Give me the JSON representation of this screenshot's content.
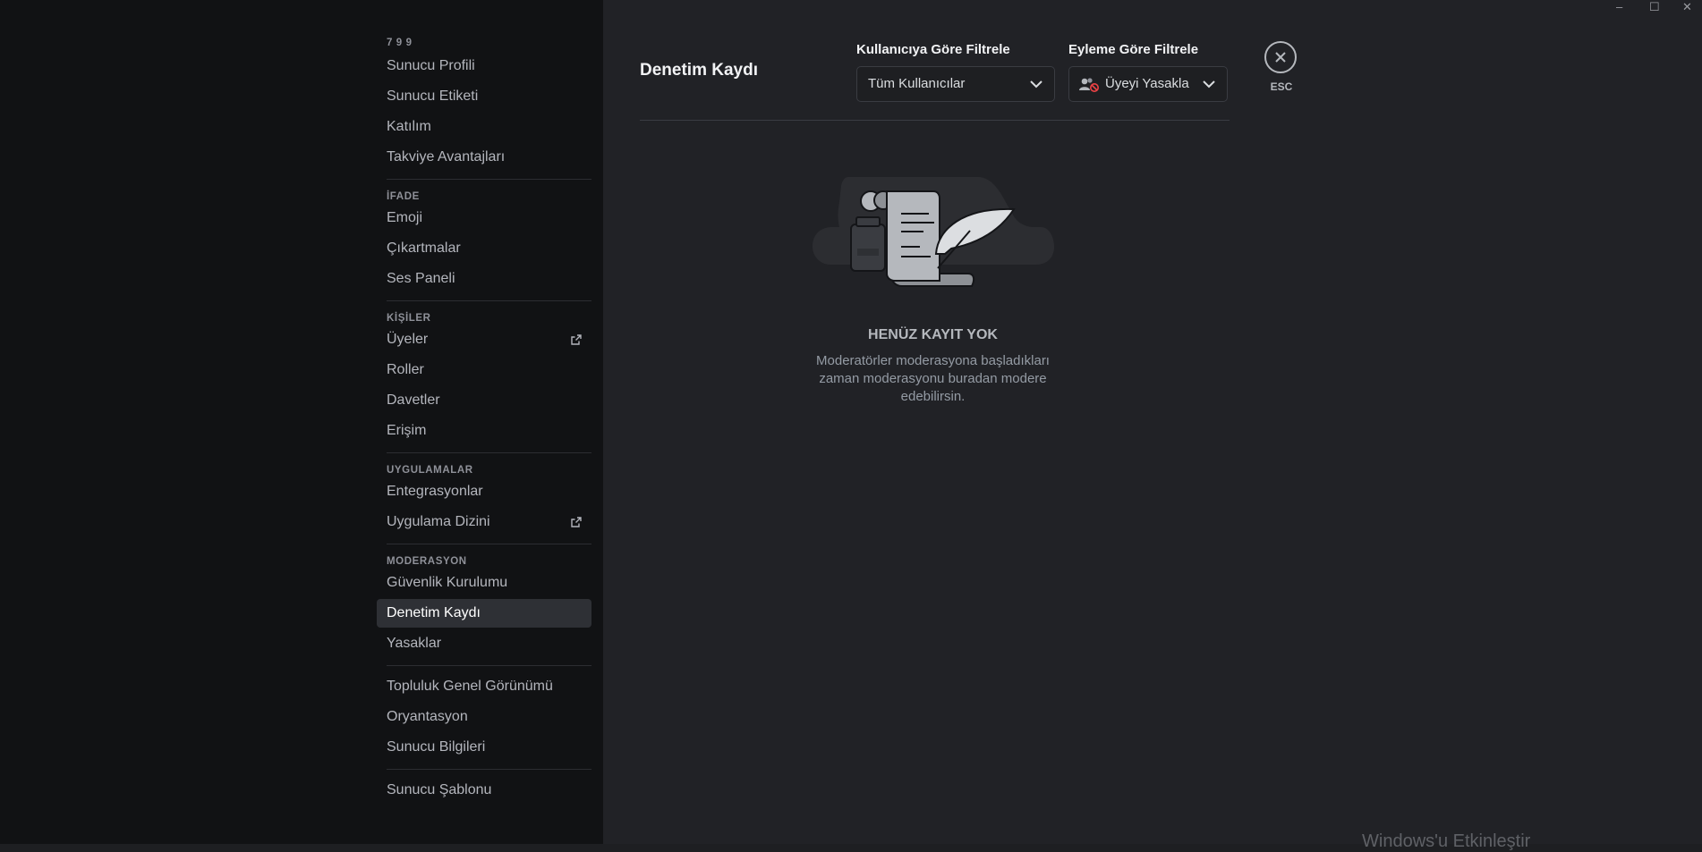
{
  "sidebar": {
    "sections": [
      {
        "header": "7 9 9",
        "items": [
          {
            "label": "Sunucu Profili"
          },
          {
            "label": "Sunucu Etiketi"
          },
          {
            "label": "Katılım"
          },
          {
            "label": "Takviye Avantajları"
          }
        ]
      },
      {
        "header": "İFADE",
        "items": [
          {
            "label": "Emoji"
          },
          {
            "label": "Çıkartmalar"
          },
          {
            "label": "Ses Paneli"
          }
        ]
      },
      {
        "header": "KİŞİLER",
        "items": [
          {
            "label": "Üyeler",
            "external": true
          },
          {
            "label": "Roller"
          },
          {
            "label": "Davetler"
          },
          {
            "label": "Erişim"
          }
        ]
      },
      {
        "header": "UYGULAMALAR",
        "items": [
          {
            "label": "Entegrasyonlar"
          },
          {
            "label": "Uygulama Dizini",
            "external": true
          }
        ]
      },
      {
        "header": "MODERASYON",
        "items": [
          {
            "label": "Güvenlik Kurulumu"
          },
          {
            "label": "Denetim Kaydı",
            "active": true
          },
          {
            "label": "Yasaklar"
          }
        ]
      },
      {
        "header": "",
        "items": [
          {
            "label": "Topluluk Genel Görünümü"
          },
          {
            "label": "Oryantasyon"
          },
          {
            "label": "Sunucu Bilgileri"
          }
        ]
      },
      {
        "header": "",
        "items": [
          {
            "label": "Sunucu Şablonu"
          }
        ]
      }
    ]
  },
  "main": {
    "title": "Denetim Kaydı",
    "user_filter": {
      "label": "Kullanıcıya Göre Filtrele",
      "value": "Tüm Kullanıcılar"
    },
    "action_filter": {
      "label": "Eyleme Göre Filtrele",
      "value": "Üyeyi Yasakla",
      "icon": "member-ban-icon"
    },
    "close": {
      "label": "ESC",
      "icon": "close-icon"
    },
    "empty": {
      "title": "HENÜZ KAYIT YOK",
      "description": "Moderatörler moderasyona başladıkları zaman moderasyonu buradan modere edebilirsin."
    }
  },
  "system": {
    "watermark": "Windows'u Etkinleştir",
    "window_controls": [
      "minimize",
      "maximize",
      "close"
    ]
  },
  "colors": {
    "sidebar_bg": "#111214",
    "main_bg": "#212226",
    "active_item_bg": "#2e3035",
    "ban_icon_red": "#ed4245"
  }
}
